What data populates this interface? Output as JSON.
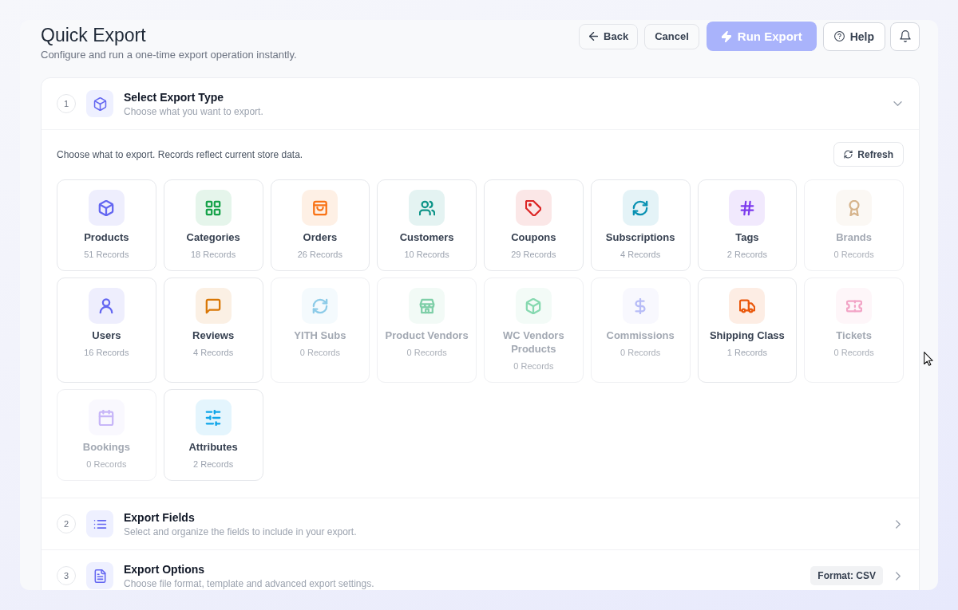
{
  "header": {
    "title": "Quick Export",
    "subtitle": "Configure and run a one-time export operation instantly."
  },
  "toolbar": [
    {
      "kind": "back",
      "label": "Back",
      "disabled": false
    },
    {
      "kind": "plain",
      "label": "Cancel",
      "disabled": false
    },
    {
      "kind": "primary",
      "label": "Run Export",
      "disabled": true
    },
    {
      "kind": "help",
      "label": "Help",
      "disabled": false
    },
    {
      "kind": "notifications",
      "disabled": false
    }
  ],
  "sections": [
    {
      "step": "1",
      "title": "Select Export Type",
      "subtitle": "Choose what you want to export.",
      "expanded": true,
      "intro": "Choose what to export. Records reflect current store data.",
      "refresh_label": "Refresh",
      "types": [
        {
          "label": "Products",
          "records": "51 Records",
          "color": "#6366f1",
          "disabled": false
        },
        {
          "label": "Categories",
          "records": "18 Records",
          "color": "#16a34a",
          "disabled": false
        },
        {
          "label": "Orders",
          "records": "26 Records",
          "color": "#f97316",
          "disabled": false
        },
        {
          "label": "Customers",
          "records": "10 Records",
          "color": "#0d9488",
          "disabled": false
        },
        {
          "label": "Coupons",
          "records": "29 Records",
          "color": "#dc2626",
          "disabled": false
        },
        {
          "label": "Subscriptions",
          "records": "4 Records",
          "color": "#0891b2",
          "disabled": false
        },
        {
          "label": "Tags",
          "records": "2 Records",
          "color": "#7c3aed",
          "disabled": false
        },
        {
          "label": "Brands",
          "records": "0 Records",
          "color": "#d6b48c",
          "disabled": true
        },
        {
          "label": "Users",
          "records": "16 Records",
          "color": "#6366f1",
          "disabled": false
        },
        {
          "label": "Reviews",
          "records": "4 Records",
          "color": "#d97706",
          "disabled": false
        },
        {
          "label": "YITH Subs",
          "records": "0 Records",
          "color": "#8ccbe8",
          "disabled": true
        },
        {
          "label": "Product Vendors",
          "records": "0 Records",
          "color": "#7fcfa8",
          "disabled": true
        },
        {
          "label": "WC Vendors Products",
          "records": "0 Records",
          "color": "#86d9b0",
          "disabled": true
        },
        {
          "label": "Commissions",
          "records": "0 Records",
          "color": "#b7bcf7",
          "disabled": true
        },
        {
          "label": "Shipping Class",
          "records": "1 Records",
          "color": "#ea580c",
          "disabled": false
        },
        {
          "label": "Tickets",
          "records": "0 Records",
          "color": "#f2a4c6",
          "disabled": true
        },
        {
          "label": "Bookings",
          "records": "0 Records",
          "color": "#c7b6f8",
          "disabled": true
        },
        {
          "label": "Attributes",
          "records": "2 Records",
          "color": "#0ea5e9",
          "disabled": false
        }
      ]
    },
    {
      "step": "2",
      "title": "Export Fields",
      "subtitle": "Select and organize the fields to include in your export.",
      "expanded": false
    },
    {
      "step": "3",
      "title": "Export Options",
      "subtitle": "Choose file format, template and advanced export settings.",
      "badge": "Format: CSV",
      "expanded": false
    }
  ]
}
